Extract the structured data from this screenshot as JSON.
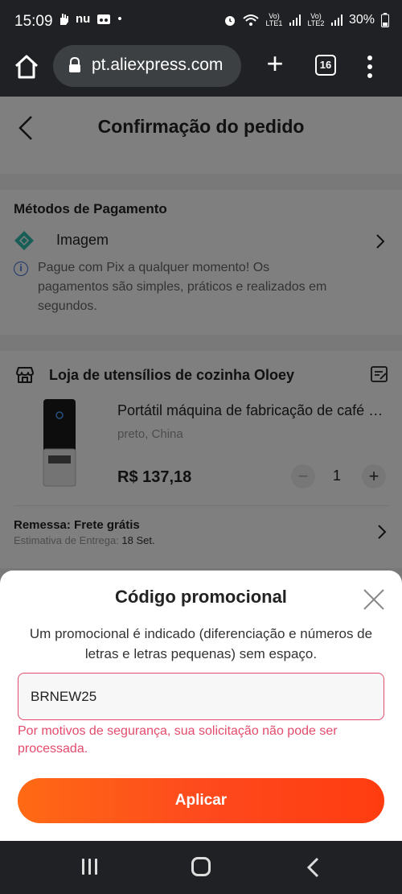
{
  "status_bar": {
    "time": "15:09",
    "left_icons": [
      "hand-icon",
      "nu-icon",
      "game-icon",
      "dot-icon"
    ],
    "left_text": {
      "nu": "nu",
      "dot": "•"
    },
    "volte1": "Vo) LTE1",
    "volte2": "Vo) LTE2",
    "battery": "30%"
  },
  "browser": {
    "url": "pt.aliexpress.com",
    "tab_count": "16"
  },
  "header": {
    "title": "Confirmação do pedido"
  },
  "payment": {
    "heading": "Métodos de Pagamento",
    "method": "Imagem",
    "info": "Pague com Pix a qualquer momento! Os pagamentos são simples, práticos e realizados em segundos."
  },
  "store": {
    "name": "Loja de utensílios de cozinha Oloey",
    "product": {
      "name": "Portátil máquina de fabricação de café elétrica",
      "variant": "preto, China",
      "price": "R$ 137,18",
      "quantity": "1",
      "minus": "−",
      "plus": "+"
    },
    "shipping": {
      "title": "Remessa: Frete grátis",
      "estimate_label": "Estimativa de Entrega:",
      "estimate_value": "18 Set."
    }
  },
  "promo_sheet": {
    "title": "Código promocional",
    "description": "Um promocional é indicado (diferenciação e números de letras e letras pequenas) sem espaço.",
    "input_value": "BRNEW25",
    "error": "Por motivos de segurança, sua solicitação não pode ser processada.",
    "apply_label": "Aplicar"
  },
  "colors": {
    "accent_orange": "#ff4b1c",
    "error_red": "#e34b6c",
    "pix_teal": "#32bcad",
    "info_blue": "#3b6fd8"
  }
}
